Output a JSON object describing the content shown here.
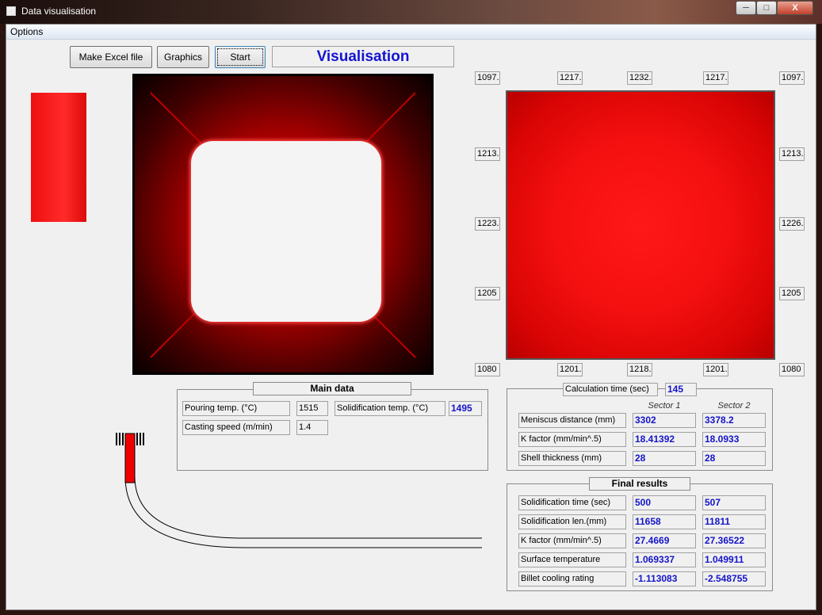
{
  "window": {
    "title": "Data visualisation",
    "minimize": "─",
    "maximize": "□",
    "close": "X"
  },
  "menu": {
    "options": "Options"
  },
  "toolbar": {
    "excel_label": "Make Excel file",
    "graphics_label": "Graphics",
    "start_label": "Start",
    "visualisation_title": "Visualisation"
  },
  "colors": {
    "accent_blue": "#1414d2",
    "hot_red": "#ff1818"
  },
  "grid_labels": {
    "top": [
      "1097.:",
      "1217.:",
      "1232.:",
      "1217.:",
      "1097.:"
    ],
    "left": [
      "1213.!",
      "1223.!",
      "1205"
    ],
    "right": [
      "1213.!",
      "1226.0",
      "1205"
    ],
    "bottom": [
      "1080",
      "1201.(",
      "1218.!",
      "1201.(",
      "1080"
    ]
  },
  "main_data": {
    "title": "Main data",
    "pouring_label": "Pouring temp. (°C)",
    "pouring_value": "1515",
    "solid_label": "Solidification temp. (°C)",
    "solid_value": "1495",
    "speed_label": "Casting speed (m/min)",
    "speed_value": "1.4"
  },
  "calc": {
    "time_label": "Calculation time (sec)",
    "time_value": "145",
    "sector1": "Sector 1",
    "sector2": "Sector 2",
    "rows": [
      {
        "label": "Meniscus distance (mm)",
        "s1": "3302",
        "s2": "3378.2"
      },
      {
        "label": "K factor (mm/min^.5)",
        "s1": "18.41392",
        "s2": "18.0933"
      },
      {
        "label": "Shell thickness (mm)",
        "s1": "28",
        "s2": "28"
      }
    ]
  },
  "final": {
    "title": "Final results",
    "rows": [
      {
        "label": "Solidification time (sec)",
        "s1": "500",
        "s2": "507"
      },
      {
        "label": "Solidification len.(mm)",
        "s1": "11658",
        "s2": "11811"
      },
      {
        "label": "K factor (mm/min^.5)",
        "s1": "27.4669",
        "s2": "27.36522"
      },
      {
        "label": "Surface temperature",
        "s1": "1.069337",
        "s2": "1.049911"
      },
      {
        "label": "Billet cooling rating",
        "s1": "-1.113083",
        "s2": "-2.548755"
      }
    ]
  }
}
